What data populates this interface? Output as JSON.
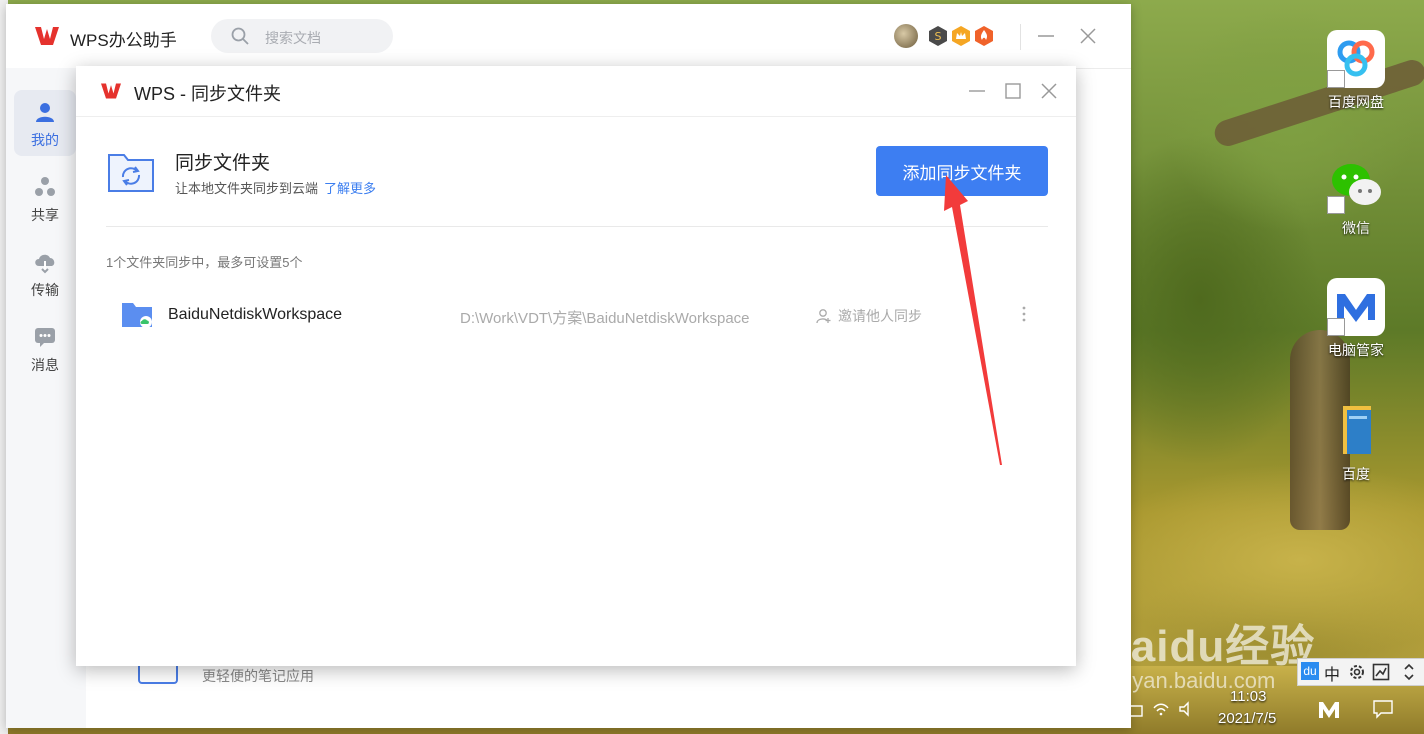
{
  "main_window": {
    "title": "WPS办公助手",
    "search_placeholder": "搜索文档",
    "sidebar": [
      {
        "label": "我的",
        "active": true,
        "icon": "user-icon"
      },
      {
        "label": "共享",
        "active": false,
        "icon": "share-icon"
      },
      {
        "label": "传输",
        "active": false,
        "icon": "cloud-transfer-icon"
      },
      {
        "label": "消息",
        "active": false,
        "icon": "message-icon"
      }
    ],
    "bottom_text": "更轻便的笔记应用"
  },
  "dialog": {
    "title": "WPS - 同步文件夹",
    "header_title": "同步文件夹",
    "header_subtitle": "让本地文件夹同步到云端",
    "learn_more": "了解更多",
    "add_button": "添加同步文件夹",
    "count_text": "1个文件夹同步中，最多可设置5个",
    "folders": [
      {
        "name": "BaiduNetdiskWorkspace",
        "path": "D:\\Work\\VDT\\方案\\BaiduNetdiskWorkspace",
        "invite": "邀请他人同步"
      }
    ]
  },
  "desktop_icons": [
    {
      "label": "百度网盘",
      "icon": "baidu-netdisk-icon"
    },
    {
      "label": "微信",
      "icon": "wechat-icon"
    },
    {
      "label": "电脑管家",
      "icon": "pc-manager-icon"
    },
    {
      "label": "百度",
      "icon": "book-icon"
    }
  ],
  "watermark": {
    "text": "Baidu经验",
    "sub": "jingyan.baidu.com"
  },
  "ime": {
    "du": "du",
    "lang": "中"
  },
  "taskbar": {
    "time": "11:03",
    "date": "2021/7/5"
  },
  "colors": {
    "accent": "#3d7ef2",
    "arrow": "#f23b3b",
    "link": "#3b7ef0"
  }
}
